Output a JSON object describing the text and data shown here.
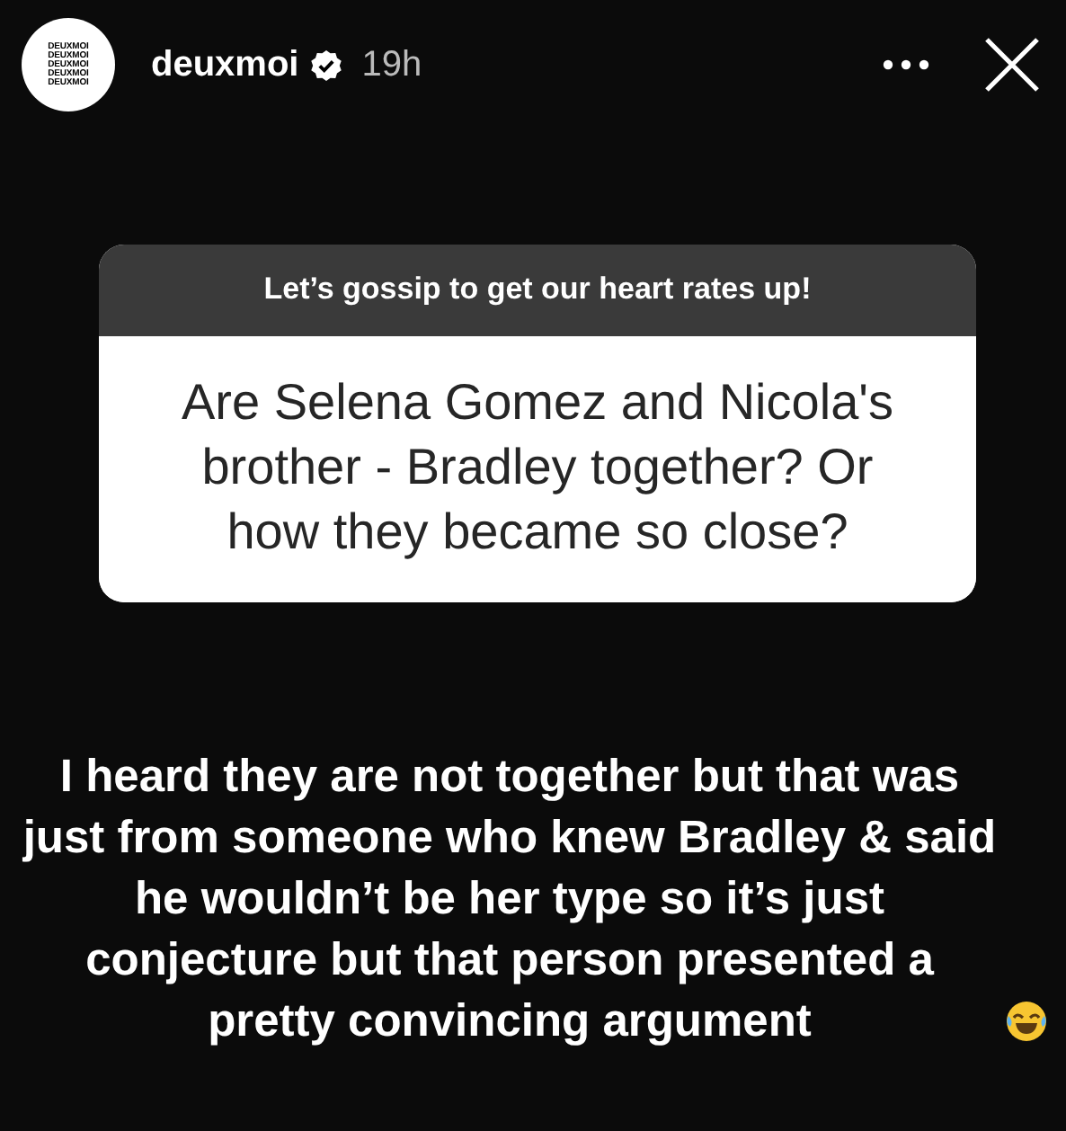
{
  "header": {
    "avatar_lines": [
      "DEUXMOI",
      "DEUXMOI",
      "DEUXMOI",
      "DEUXMOI",
      "DEUXMOI"
    ],
    "username": "deuxmoi",
    "verified": true,
    "time": "19h"
  },
  "question_card": {
    "prompt": "Let’s gossip to get our heart rates up!",
    "question": "Are Selena Gomez and Nicola's brother - Bradley together? Or how they became so close?"
  },
  "answer": "I heard they are not together but that was just from someone who knew Bradley & said he wouldn’t be her type so it’s just conjecture but that person presented a pretty convincing argument"
}
